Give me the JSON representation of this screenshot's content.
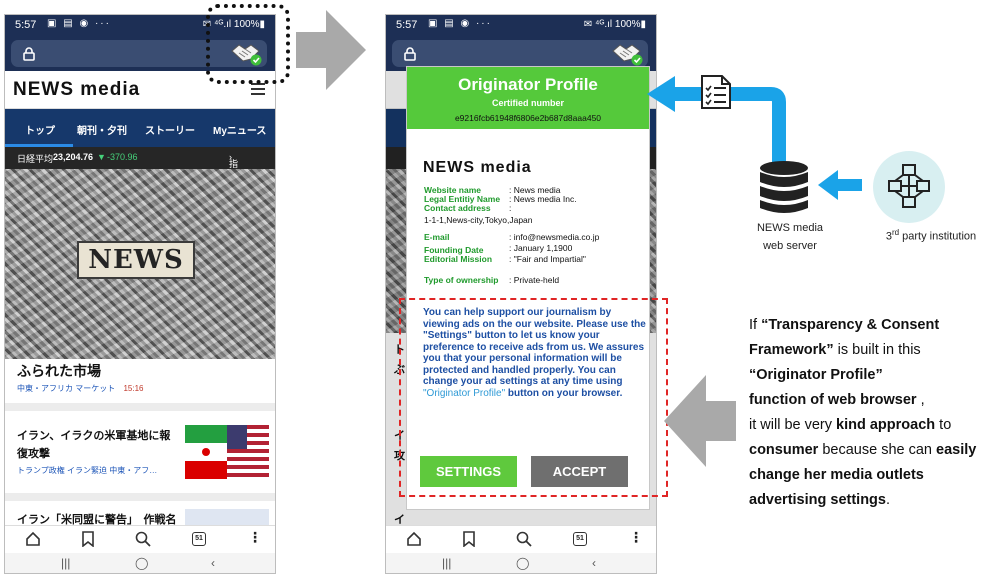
{
  "status_bar": {
    "time": "5:57",
    "battery": "100%"
  },
  "left_phone": {
    "brand": "NEWS media",
    "nav_tabs": [
      "トップ",
      "朝刊・夕刊",
      "ストーリー",
      "Myニュース"
    ],
    "ticker": {
      "label": "日経平均",
      "value": "23,204.76",
      "change": "-370.96",
      "link": "指数一覧"
    },
    "hero_text": "NEWS",
    "article1": {
      "title": "ふられた市場",
      "region": "中東・アフリカ",
      "category": "マーケット",
      "time": "15:16"
    },
    "article2": {
      "title": "イラン、イラクの米軍基地に報復攻撃",
      "tags": "トランプ政権  イラン緊迫  中東・アフ…"
    },
    "article3": {
      "title": "イラン「米同盟に警告」　作戦名"
    },
    "tab_count": "51"
  },
  "right_phone": {
    "originator_profile": {
      "title": "Originator Profile",
      "certified_label": "Certified number",
      "certified_number": "e9216fcb61948f6806e2b687d8aaa450",
      "brand": "NEWS media",
      "fields": [
        {
          "label": "Website name",
          "value": "News media"
        },
        {
          "label": "Legal Entitiy Name",
          "value": "News media Inc."
        },
        {
          "label": "Contact address",
          "value": ""
        },
        {
          "label": "",
          "value": "1-1-1,News-city,Tokyo,Japan"
        },
        {
          "label": "E-mail",
          "value": "info@newsmedia.co.jp"
        },
        {
          "label": "Founding Date",
          "value": "January 1,1900"
        },
        {
          "label": "Editorial Mission",
          "value": "\"Fair and Impartial\""
        },
        {
          "label": "Type of ownership",
          "value": "Private-held"
        }
      ],
      "support_text_before": "You can help support our journalism by viewing ads on the our website. Please use the \"Settings\" button to let us know your preference to receive ads from us. We assures you that your personal information will be protected and handled properly. You can change your ad settings at any time using ",
      "support_text_quote": "\"Originator Profile\"",
      "support_text_after": " button on your browser.",
      "settings_button": "SETTINGS",
      "accept_button": "ACCEPT"
    },
    "peek_chars": [
      "ト",
      "ぶ",
      "イ",
      "攻",
      "イ"
    ],
    "tab_count": "51"
  },
  "diagram": {
    "server_label_line1": "NEWS media",
    "server_label_line2": "web server",
    "institution_prefix": "3",
    "institution_sup": "rd",
    "institution_label": " party institution",
    "arrow_color": "#1aa3e8",
    "gray_arrow_color": "#a9a9a9"
  },
  "explanation": {
    "p1": "If ",
    "p2": "“Transparency & Consent Framework”",
    "p3": " is built in this ",
    "p4": "“Originator Profile”",
    "p5": "function of web browser",
    "p6": " ,",
    "p7": "it will be very ",
    "p8": "kind approach",
    "p9": " to ",
    "p10": "consumer",
    "p11": " because she can ",
    "p12": "easily change her media outlets advertising settings",
    "p13": "."
  }
}
